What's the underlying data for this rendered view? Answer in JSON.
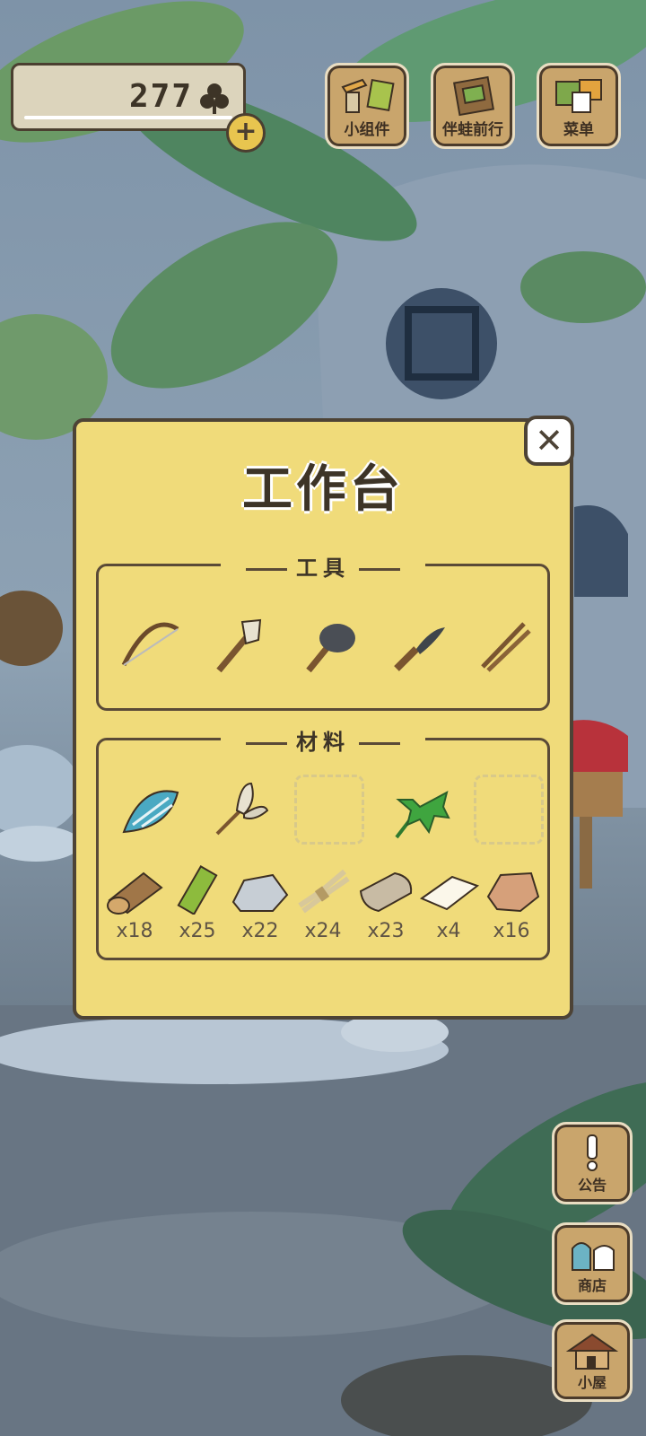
{
  "hud": {
    "clover_count": "277",
    "widgets_label": "小组件",
    "travel_label": "伴蛙前行",
    "menu_label": "菜单"
  },
  "side": {
    "notice_label": "公告",
    "shop_label": "商店",
    "house_label": "小屋"
  },
  "dialog": {
    "title": "工作台",
    "tools_title": "工具",
    "materials_title": "材料",
    "tools": [
      "bow-icon",
      "brush-icon",
      "stone-hammer-icon",
      "knife-icon",
      "sticks-icon"
    ],
    "materials": [
      {
        "icon": "shell-icon",
        "empty": false
      },
      {
        "icon": "feather-bundle-icon",
        "empty": false
      },
      {
        "icon": "empty-slot",
        "empty": true
      },
      {
        "icon": "palm-leaf-icon",
        "empty": false
      },
      {
        "icon": "empty-slot",
        "empty": true
      }
    ],
    "resources": [
      {
        "icon": "wood-log-icon",
        "count": "x18"
      },
      {
        "icon": "bamboo-icon",
        "count": "x25"
      },
      {
        "icon": "stone-icon",
        "count": "x22"
      },
      {
        "icon": "fiber-bundle-icon",
        "count": "x24"
      },
      {
        "icon": "cloth-roll-icon",
        "count": "x23"
      },
      {
        "icon": "paper-icon",
        "count": "x4"
      },
      {
        "icon": "leather-icon",
        "count": "x16"
      }
    ]
  },
  "colors": {
    "dialog_bg": "#f0db7a",
    "border": "#4d4336",
    "wood_button": "#c9a56c"
  }
}
